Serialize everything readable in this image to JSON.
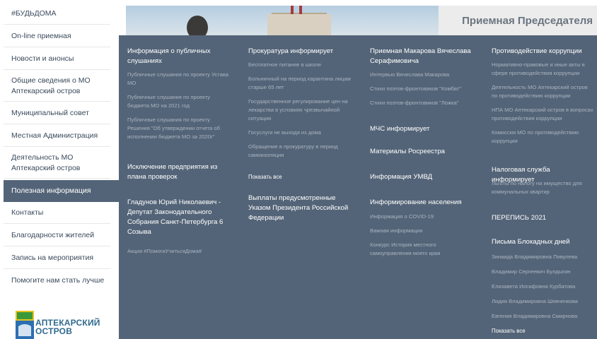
{
  "sidebar": {
    "items": [
      {
        "label": "#БУДЬДОМА"
      },
      {
        "label": "On-line приемная"
      },
      {
        "label": "Новости и анонсы"
      },
      {
        "label": "Общие сведения о МО Аптекарский остров"
      },
      {
        "label": "Муниципальный совет"
      },
      {
        "label": "Местная Администрация"
      },
      {
        "label": "Деятельность МО Аптекарский остров"
      },
      {
        "label": "Полезная информация"
      },
      {
        "label": "Контакты"
      },
      {
        "label": "Благодарности жителей"
      },
      {
        "label": "Запись на мероприятия"
      },
      {
        "label": "Помогите нам стать лучше"
      }
    ],
    "logo_text": "АПТЕКАРСКИЙ ОСТРОВ"
  },
  "header": {
    "reception_title": "Приемная Председателя"
  },
  "menu": {
    "col1": {
      "h1": "Информация о публичных слушаниях",
      "links1": [
        "Публичные слушания по проекту Устава МО",
        "Публичные слушания по проекту бюджета МО на 2021 год",
        "Публичные слушания по проекту Решения \"Об утверждении отчета об исполнении бюджета МО за 2020г\""
      ],
      "h2": "Исключение предприятия из плана проверок",
      "h3": "Гладунов Юрий Николаевич - Депутат Законодательного Собрания Санкт-Петербурга 6 Созыва",
      "links3": [
        "Акция #ПомогиУчитьсяДома#"
      ]
    },
    "col2": {
      "h1": "Прокуратура информирует",
      "links1": [
        "Бесплатное питание в школе",
        "Больничный на период карантина лицам старше 65 лет",
        "Государственное регулирование цен на лекарства в условиях чрезвычайной ситуации",
        "Госуслуги не выходя из дома",
        "Обращение в прокуратуру в период самоизоляции"
      ],
      "more": "Показать все",
      "h2": "Выплаты предусмотренные Указом Президента Российской Федерации"
    },
    "col3": {
      "h1": "Приемная Макарова Вячеслава Серафимовича",
      "links1": [
        "Интервью Вячеслава Макарова",
        "Стихи поэтов-фронтовиков \"Комбат\"",
        "Стихи поэтов-фронтовиков \"Ложка\""
      ],
      "h2": "МЧС информирует",
      "h3": "Материалы Росреестра",
      "h4": "Информация УМВД",
      "h5": "Информирование населения",
      "links5": [
        "Информация о COVID-19",
        "Важная информация",
        "Конкурс История местного самоуправления моего края"
      ]
    },
    "col4": {
      "h1": "Противодействие коррупции",
      "links1": [
        "Нормативно-правовые и иные акты в сфере противодействия коррупции",
        "Деятельность МО Аптекарский остров по противодействию коррупции",
        "НПА МО Аптекарский остров в вопросах противодействия коррупции",
        "Комиссия МО по противодействию коррупции"
      ],
      "h2": "Налоговая служба информирует",
      "links2": [
        "Льготы по налогу на имущество для коммунальных квартир"
      ],
      "h3": "ПЕРЕПИСЬ 2021",
      "h4": "Письма Блокадных дней",
      "links4": [
        "Зинаида Владимировна Пивулева",
        "Владимир Сергеевич Булдыгин",
        "Елизавета Иосифовна Курбатова",
        "Лидия Владимировна Шевченкова",
        "Евгения Владимировна Смирнова"
      ],
      "more": "Показать все"
    }
  }
}
